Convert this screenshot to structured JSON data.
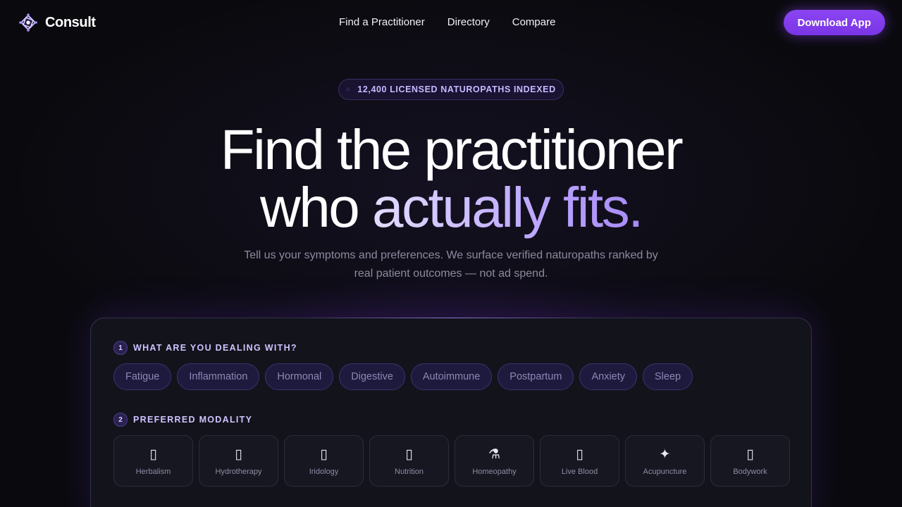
{
  "nav": {
    "brand": "Consult",
    "links": [
      "Find a Practitioner",
      "Directory",
      "Compare"
    ],
    "download_label": "Download App"
  },
  "hero": {
    "badge": "12,400 LICENSED NATUROPATHS INDEXED",
    "headline_line1": "Find the practitioner",
    "headline_who": "who ",
    "headline_accent": "actually fits.",
    "subtext": "Tell us your symptoms and preferences. We surface verified naturopaths ranked by real patient outcomes — not ad spend."
  },
  "colors": {
    "accent": "#8b45f2",
    "background": "#0a0a0e",
    "card": "#13131c"
  },
  "step1": {
    "num": "1",
    "title": "WHAT ARE YOU DEALING WITH?",
    "chips": [
      "Fatigue",
      "Inflammation",
      "Hormonal",
      "Digestive",
      "Autoimmune",
      "Postpartum",
      "Anxiety",
      "Sleep"
    ]
  },
  "step2": {
    "num": "2",
    "title": "PREFERRED MODALITY",
    "modalities": [
      {
        "label": "Herbalism",
        "icon": "leaf-icon",
        "glyph": "▯"
      },
      {
        "label": "Hydrotherapy",
        "icon": "water-icon",
        "glyph": "▯"
      },
      {
        "label": "Iridology",
        "icon": "eye-icon",
        "glyph": "▯"
      },
      {
        "label": "Nutrition",
        "icon": "apple-icon",
        "glyph": "▯"
      },
      {
        "label": "Homeopathy",
        "icon": "flask-icon",
        "glyph": "⚗"
      },
      {
        "label": "Live Blood",
        "icon": "drop-icon",
        "glyph": "▯"
      },
      {
        "label": "Acupuncture",
        "icon": "sparkle-icon",
        "glyph": "✦"
      },
      {
        "label": "Bodywork",
        "icon": "hand-icon",
        "glyph": "▯"
      }
    ]
  }
}
